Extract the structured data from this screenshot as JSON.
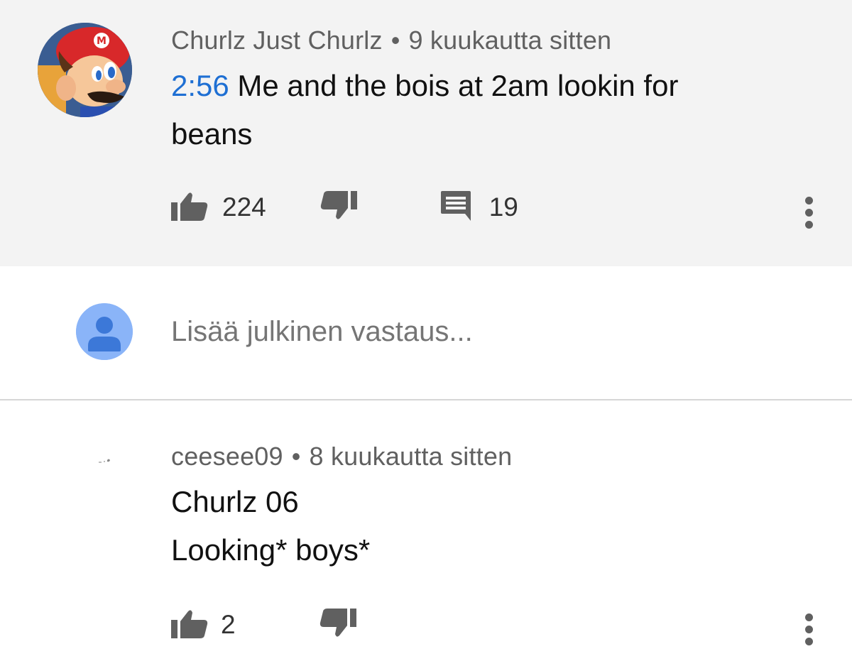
{
  "comment": {
    "author": "Churlz Just Churlz",
    "separator": "•",
    "time": "9 kuukautta sitten",
    "timestamp_link": "2:56",
    "text_line1": " Me and the bois at 2am lookin for",
    "text_line2": "beans",
    "likes": "224",
    "replies": "19",
    "avatar_icon": "mario-avatar",
    "link_color": "#1e6fd3"
  },
  "reply_box": {
    "placeholder": "Lisää julkinen vastaus..."
  },
  "reply": {
    "author": "ceesee09",
    "separator": "•",
    "time": "8 kuukautta sitten",
    "text_line1": "Churlz 06",
    "text_line2": "Looking* boys*",
    "likes": "2"
  }
}
